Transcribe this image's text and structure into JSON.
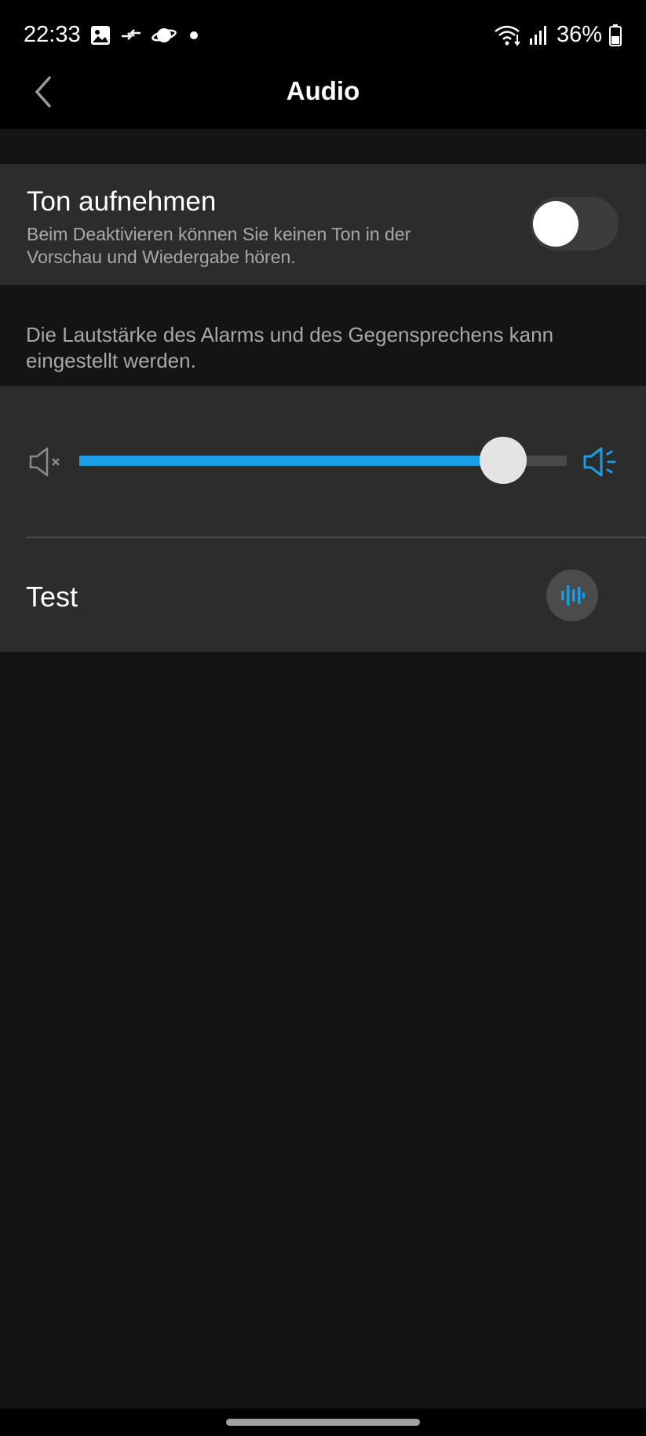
{
  "status_bar": {
    "time": "22:33",
    "battery": "36%",
    "icons_left": [
      "gallery-icon",
      "transfer-icon",
      "planet-icon",
      "dot-icon"
    ],
    "icons_right": [
      "wifi-icon",
      "signal-icon",
      "battery-icon"
    ]
  },
  "header": {
    "title": "Audio",
    "back_icon": "chevron-left-icon"
  },
  "record_audio": {
    "title": "Ton aufnehmen",
    "description": "Beim Deaktivieren können Sie keinen Ton in der Vorschau und Wiedergabe hören.",
    "enabled": false
  },
  "volume": {
    "info": "Die Lautstärke des Alarms und des Gegensprechens kann eingestellt werden.",
    "level": 0.87,
    "min_icon": "speaker-mute-icon",
    "max_icon": "speaker-loud-icon",
    "accent_color": "#1a9ee6"
  },
  "test": {
    "label": "Test",
    "icon": "sound-wave-icon"
  }
}
